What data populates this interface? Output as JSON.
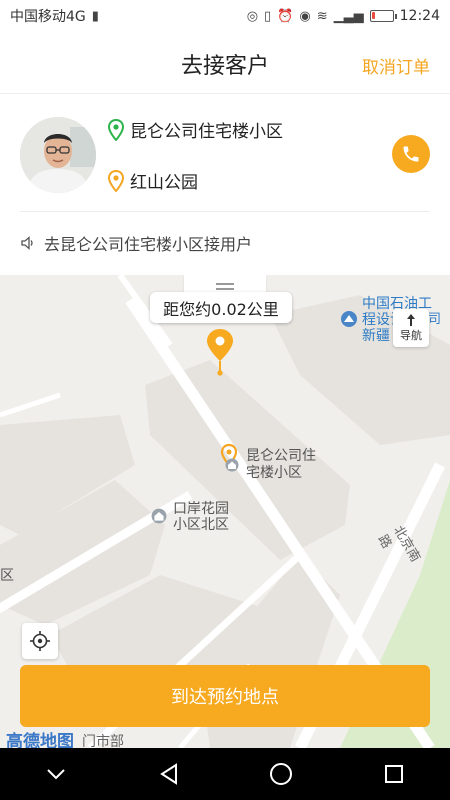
{
  "status_bar": {
    "carrier": "中国移动4G",
    "network": "4G",
    "time": "12:24",
    "battery_level": 0.15
  },
  "header": {
    "title": "去接客户",
    "cancel_label": "取消订单"
  },
  "customer": {
    "pickup": "昆仑公司住宅楼小区",
    "destination": "红山公园",
    "voice_hint": "去昆仑公司住宅楼小区接用户"
  },
  "map": {
    "distance": "距您约0.02公里",
    "poi_oil_line1": "中国石油工",
    "poi_oil_line2": "程设计",
    "poi_oil_line3": "新疆",
    "poi_oil_tail": "司",
    "nav_label": "导航",
    "poi_pickup_line1": "昆仑公司住",
    "poi_pickup_line2": "宅楼小区",
    "poi_kouan_line1": "口岸花园",
    "poi_kouan_line2": "小区北区",
    "road_label": "北京南路",
    "edge_label": "区",
    "brand": "高德地图",
    "bottom_street": "门市部"
  },
  "actions": {
    "arrive_label": "到达预约地点"
  },
  "colors": {
    "accent": "#f7a91f",
    "start_pin": "#2db34a",
    "poi_blue": "#2d7bc4"
  }
}
